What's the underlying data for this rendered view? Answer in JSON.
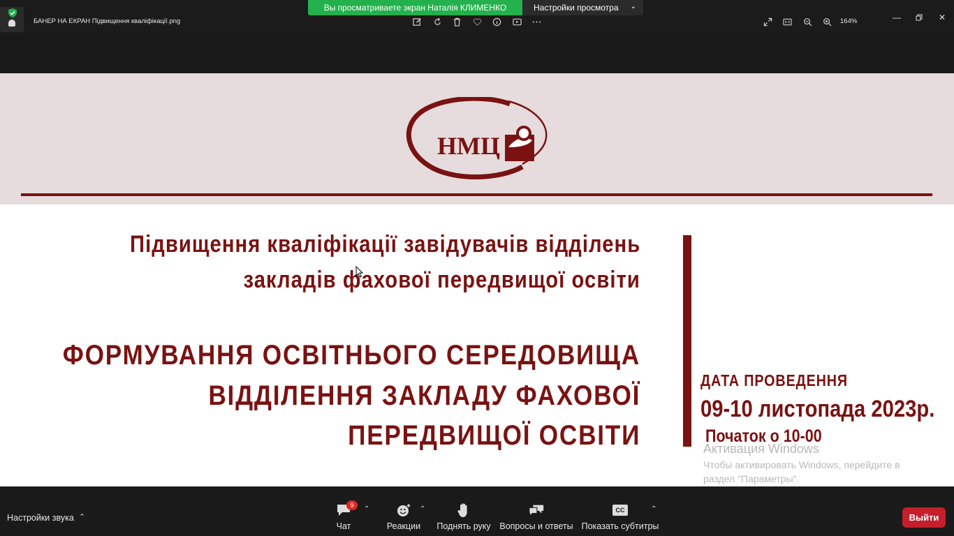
{
  "window": {
    "title": "БАНЕР НА ЕКРАН Підвищення кваліфікації.png",
    "zoom": "164%"
  },
  "share": {
    "banner": "Вы просматриваете экран Наталія КЛИМЕНКО",
    "view_settings": "Настройки просмотра"
  },
  "slide": {
    "logo_text": "НМЦ",
    "heading_line1": "Підвищення кваліфікації завідувачів відділень",
    "heading_line2": "закладів фахової передвищої освіти",
    "topic_line1": "ФОРМУВАННЯ ОСВІТНЬОГО СЕРЕДОВИЩА",
    "topic_line2": "ВІДДІЛЕННЯ ЗАКЛАДУ ФАХОВОЇ",
    "topic_line3": "ПЕРЕДВИЩОЇ ОСВІТИ",
    "date_label": "ДАТА ПРОВЕДЕННЯ",
    "date_value": "09-10 листопада 2023р.",
    "start_time": "Початок о 10-00",
    "accent_color": "#7a1212"
  },
  "windows_activation": {
    "title": "Активация Windows",
    "text": "Чтобы активировать Windows, перейдите в раздел \"Параметры\"."
  },
  "toolbar": {
    "audio_settings": "Настройки звука",
    "chat": "Чат",
    "chat_badge": "9",
    "reactions": "Реакции",
    "raise_hand": "Поднять руку",
    "qa": "Вопросы и ответы",
    "captions": "Показать субтитры",
    "captions_icon_text": "CC",
    "exit": "Выйти"
  }
}
